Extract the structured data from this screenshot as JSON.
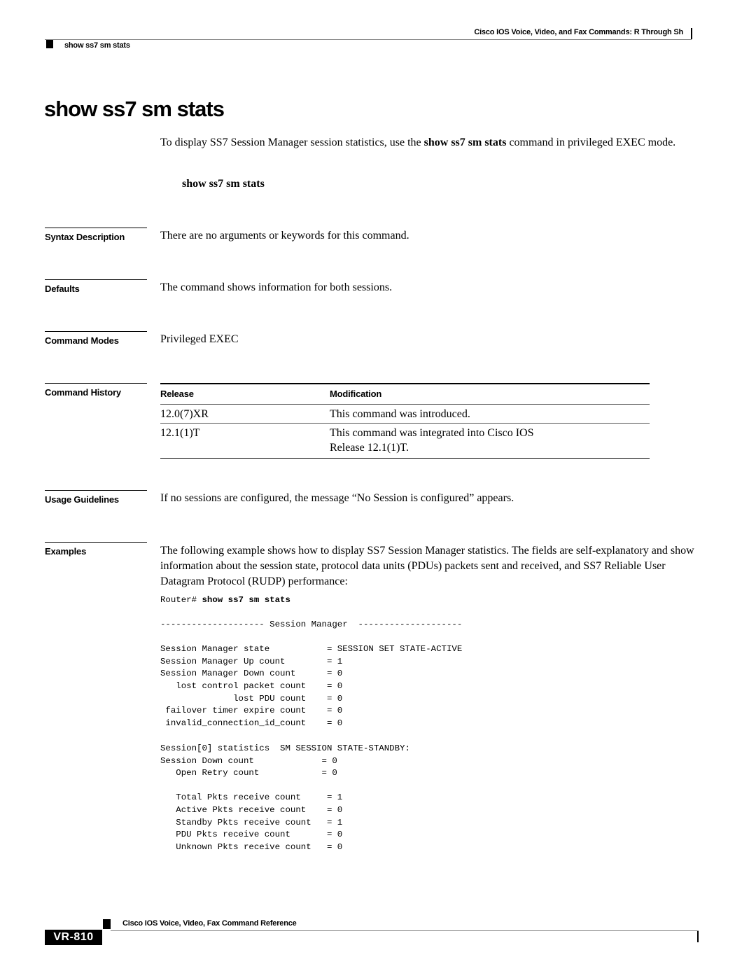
{
  "header": {
    "book_title": "Cisco IOS Voice, Video, and Fax Commands: R Through Sh",
    "breadcrumb": "show ss7 sm stats"
  },
  "page_title": "show ss7 sm stats",
  "intro": {
    "before": "To display SS7 Session Manager session statistics, use the ",
    "command": "show ss7 sm stats",
    "after": " command in privileged EXEC mode."
  },
  "syntax_command": "show ss7 sm stats",
  "sections": {
    "syntax_description": {
      "label": "Syntax Description",
      "text": "There are no arguments or keywords for this command."
    },
    "defaults": {
      "label": "Defaults",
      "text": "The command shows information for both sessions."
    },
    "command_modes": {
      "label": "Command Modes",
      "text": "Privileged EXEC"
    },
    "command_history": {
      "label": "Command History",
      "columns": [
        "Release",
        "Modification"
      ],
      "rows": [
        {
          "release": "12.0(7)XR",
          "modification": "This command was introduced."
        },
        {
          "release": "12.1(1)T",
          "modification_line1": "This command was integrated into Cisco IOS",
          "modification_line2": "Release 12.1(1)T."
        }
      ]
    },
    "usage_guidelines": {
      "label": "Usage Guidelines",
      "text": "If no sessions are configured, the message “No Session is configured” appears."
    },
    "examples": {
      "label": "Examples",
      "text": "The following example shows how to display SS7 Session Manager statistics. The fields are self-explanatory and show information about the session state, protocol data units (PDUs) packets sent and received, and SS7 Reliable User Datagram Protocol (RUDP) performance:",
      "prompt": "Router# ",
      "command": "show ss7 sm stats",
      "output_block1": [
        "-------------------- Session Manager  --------------------",
        "",
        "Session Manager state           = SESSION SET STATE-ACTIVE",
        "Session Manager Up count        = 1",
        "Session Manager Down count      = 0",
        "   lost control packet count    = 0",
        "              lost PDU count    = 0",
        " failover timer expire count    = 0",
        " invalid_connection_id_count    = 0"
      ],
      "output_block2": [
        "Session[0] statistics  SM SESSION STATE-STANDBY:",
        "Session Down count             = 0",
        "   Open Retry count            = 0",
        "",
        "   Total Pkts receive count     = 1",
        "   Active Pkts receive count    = 0",
        "   Standby Pkts receive count   = 1",
        "   PDU Pkts receive count       = 0",
        "   Unknown Pkts receive count   = 0"
      ]
    }
  },
  "footer": {
    "book_title": "Cisco IOS Voice, Video, Fax Command Reference",
    "page_number": "VR-810"
  }
}
